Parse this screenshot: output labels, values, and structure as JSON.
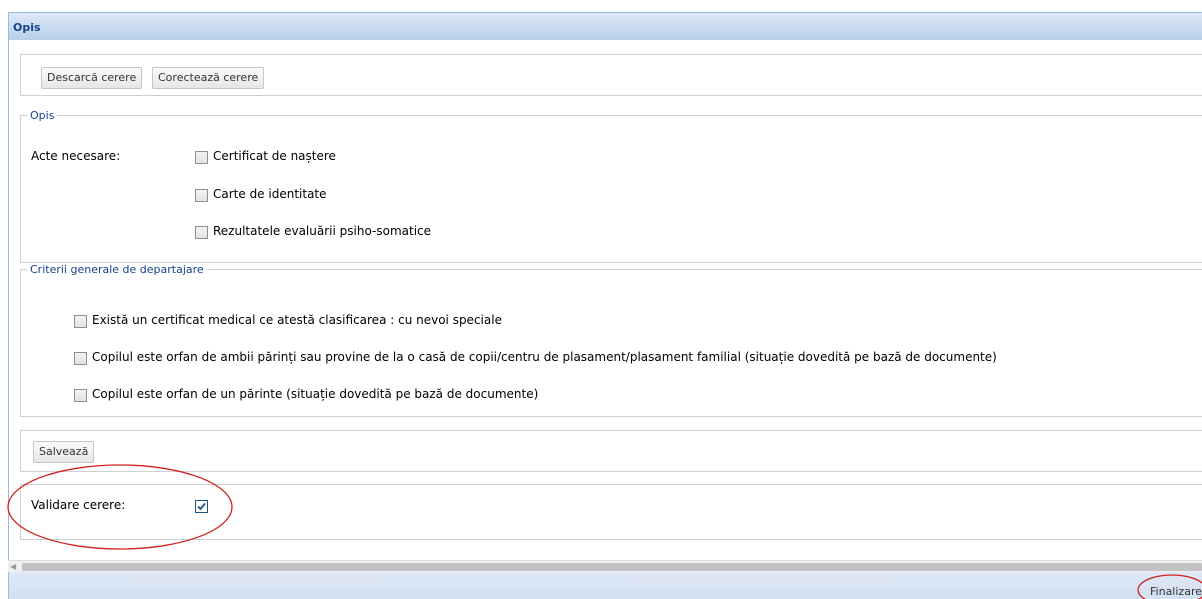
{
  "window": {
    "title": "Opis"
  },
  "toolbar": {
    "download_label": "Descarcă cerere",
    "correct_label": "Corectează cerere"
  },
  "opis": {
    "legend": "Opis",
    "label": "Acte necesare:",
    "items": [
      {
        "label": "Certificat de naștere",
        "checked": false
      },
      {
        "label": "Carte de identitate",
        "checked": false
      },
      {
        "label": "Rezultatele evaluării psiho-somatice",
        "checked": false
      }
    ]
  },
  "criteria": {
    "legend": "Criterii generale de departajare",
    "items": [
      {
        "label": "Există un certificat medical ce atestă clasificarea : cu nevoi speciale",
        "checked": false
      },
      {
        "label": "Copilul este orfan de ambii părinți sau provine de la o casă de copii/centru de plasament/plasament familial (situație dovedită pe bază de documente)",
        "checked": false
      },
      {
        "label": "Copilul este orfan de un părinte (situație dovedită pe bază de documente)",
        "checked": false
      }
    ]
  },
  "save": {
    "label": "Salvează"
  },
  "validation": {
    "label": "Validare cerere:",
    "checked": true
  },
  "footer": {
    "finalize_label": "Finalizare"
  },
  "colors": {
    "annotation": "#d21f1f",
    "header_text": "#15428b",
    "check": "#1c5180"
  },
  "icons": {
    "scroll_left": "chevron-left-icon",
    "checkmark": "check-icon"
  }
}
